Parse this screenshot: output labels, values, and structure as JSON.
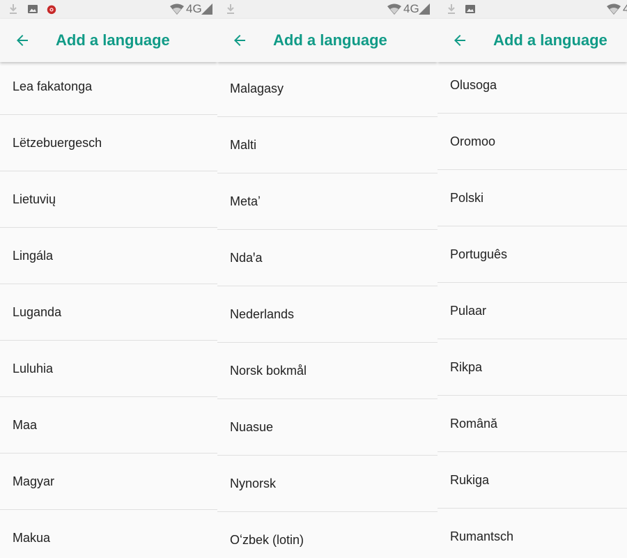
{
  "colors": {
    "accent": "#119b87",
    "status_icon": "#7a7a7a",
    "debug_icon": "#c62828"
  },
  "panels": [
    {
      "status": {
        "network": "4G",
        "icons": [
          "download-icon",
          "image-icon",
          "debug-bug-icon",
          "wifi-icon",
          "signal-icon"
        ]
      },
      "toolbar": {
        "title": "Add a language",
        "back_icon": "arrow-back-icon"
      },
      "items": [
        "Lea fakatonga",
        "Lëtzebuergesch",
        "Lietuvių",
        "Lingála",
        "Luganda",
        "Luluhia",
        "Maa",
        "Magyar",
        "Makua"
      ]
    },
    {
      "status": {
        "network": "4G",
        "icons": [
          "download-icon",
          "wifi-icon",
          "signal-icon"
        ]
      },
      "toolbar": {
        "title": "Add a language",
        "back_icon": "arrow-back-icon"
      },
      "items": [
        "Malagasy",
        "Malti",
        "Metaʼ",
        "Ndaꞌa",
        "Nederlands",
        "Norsk bokmål",
        "Nuasue",
        "Nynorsk",
        "Oʻzbek (lotin)"
      ]
    },
    {
      "status": {
        "network": "4",
        "icons": [
          "download-icon",
          "image-icon",
          "wifi-icon"
        ]
      },
      "toolbar": {
        "title": "Add a language",
        "back_icon": "arrow-back-icon"
      },
      "items": [
        "Olusoga",
        "Oromoo",
        "Polski",
        "Português",
        "Pulaar",
        "Rikpa",
        "Română",
        "Rukiga",
        "Rumantsch"
      ]
    }
  ]
}
